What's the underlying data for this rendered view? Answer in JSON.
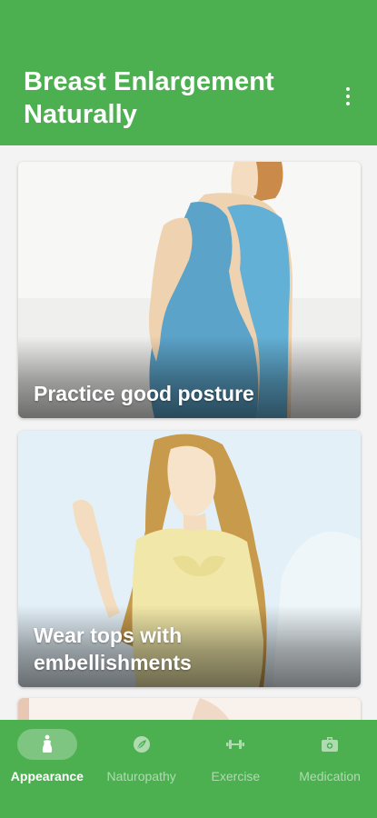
{
  "header": {
    "title": "Breast Enlargement Naturally",
    "menu_icon": "more-vertical-icon"
  },
  "cards": [
    {
      "caption": "Practice good posture"
    },
    {
      "caption": "Wear tops with embellishments"
    },
    {
      "caption": ""
    }
  ],
  "nav": {
    "items": [
      {
        "label": "Appearance",
        "icon": "figure-icon",
        "active": true
      },
      {
        "label": "Naturopathy",
        "icon": "leaf-icon",
        "active": false
      },
      {
        "label": "Exercise",
        "icon": "dumbbell-icon",
        "active": false
      },
      {
        "label": "Medication",
        "icon": "medkit-icon",
        "active": false
      }
    ]
  },
  "colors": {
    "primary": "#4caf50",
    "on_primary": "#ffffff"
  }
}
